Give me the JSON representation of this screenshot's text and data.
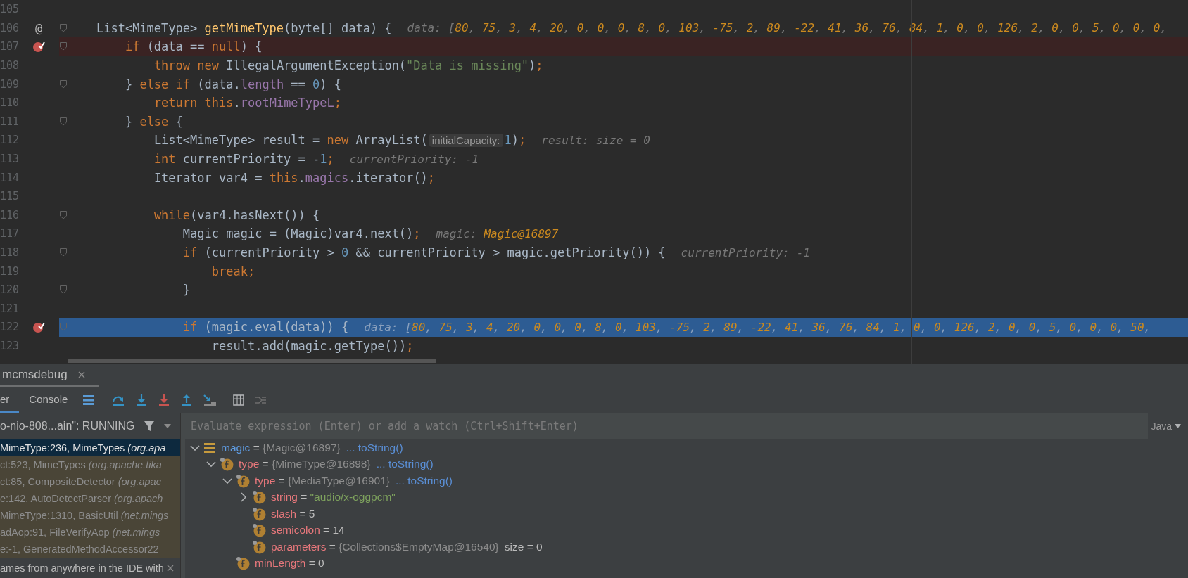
{
  "editor": {
    "lines": [
      {
        "number": "105",
        "fold": false,
        "breakpoint": false,
        "current": false
      },
      {
        "number": "106",
        "gutter_mark": "@",
        "fold": true,
        "breakpoint": false,
        "current": false,
        "segments": [
          {
            "kind": "code",
            "tokens": [
              {
                "kind": "pl",
                "text": "List<MimeType> "
              },
              {
                "kind": "decl",
                "text": "getMimeType"
              },
              {
                "kind": "pl",
                "text": "(byte[] data) {"
              }
            ]
          },
          {
            "kind": "hint",
            "label": "data:",
            "value": {
              "kind": "array",
              "text": "[80, 75, 3, 4, 20, 0, 0, 0, 8, 0, 103, -75, 2, 89, -22, 41, 36, 76, 84, 1, 0, 0, 126, 2, 0, 0, 5, 0, 0, 0,"
            }
          }
        ],
        "children": [
          {
            "number": "107",
            "fold": true,
            "breakpoint": true,
            "current": false,
            "segments": [
              {
                "kind": "code",
                "tokens": [
                  {
                    "kind": "kw",
                    "text": "if"
                  },
                  {
                    "kind": "pl",
                    "text": " (data == "
                  },
                  {
                    "kind": "kw",
                    "text": "null"
                  },
                  {
                    "kind": "pl",
                    "text": ") {"
                  }
                ]
              }
            ],
            "children": [
              {
                "number": "108",
                "fold": false,
                "breakpoint": false,
                "current": false,
                "segments": [
                  {
                    "kind": "code",
                    "tokens": [
                      {
                        "kind": "kw",
                        "text": "throw new "
                      },
                      {
                        "kind": "pl",
                        "text": "IllegalArgumentException("
                      },
                      {
                        "kind": "str",
                        "text": "\"Data is missing\""
                      },
                      {
                        "kind": "pl",
                        "text": ")"
                      },
                      {
                        "kind": "kw",
                        "text": ";"
                      }
                    ]
                  }
                ]
              }
            ]
          },
          {
            "number": "109",
            "fold": true,
            "breakpoint": false,
            "current": false,
            "segments": [
              {
                "kind": "code",
                "tokens": [
                  {
                    "kind": "pl",
                    "text": "} "
                  },
                  {
                    "kind": "kw",
                    "text": "else if"
                  },
                  {
                    "kind": "pl",
                    "text": " (data."
                  },
                  {
                    "kind": "fld",
                    "text": "length"
                  },
                  {
                    "kind": "pl",
                    "text": " == "
                  },
                  {
                    "kind": "num",
                    "text": "0"
                  },
                  {
                    "kind": "pl",
                    "text": ") {"
                  }
                ]
              }
            ],
            "children": [
              {
                "number": "110",
                "fold": false,
                "breakpoint": false,
                "current": false,
                "segments": [
                  {
                    "kind": "code",
                    "tokens": [
                      {
                        "kind": "kw",
                        "text": "return this"
                      },
                      {
                        "kind": "pl",
                        "text": "."
                      },
                      {
                        "kind": "fld",
                        "text": "rootMimeTypeL"
                      },
                      {
                        "kind": "kw",
                        "text": ";"
                      }
                    ]
                  }
                ]
              }
            ]
          },
          {
            "number": "111",
            "fold": true,
            "breakpoint": false,
            "current": false,
            "segments": [
              {
                "kind": "code",
                "tokens": [
                  {
                    "kind": "pl",
                    "text": "} "
                  },
                  {
                    "kind": "kw",
                    "text": "else"
                  },
                  {
                    "kind": "pl",
                    "text": " {"
                  }
                ]
              }
            ],
            "children": [
              {
                "number": "112",
                "fold": false,
                "breakpoint": false,
                "current": false,
                "segments": [
                  {
                    "kind": "code",
                    "tokens": [
                      {
                        "kind": "pl",
                        "text": "List<MimeType> result = "
                      },
                      {
                        "kind": "kw",
                        "text": "new "
                      },
                      {
                        "kind": "pl",
                        "text": "ArrayList("
                      }
                    ]
                  },
                  {
                    "kind": "chip",
                    "text": "initialCapacity:"
                  },
                  {
                    "kind": "code",
                    "tokens": [
                      {
                        "kind": "num",
                        "text": "1"
                      },
                      {
                        "kind": "pl",
                        "text": ")"
                      },
                      {
                        "kind": "kw",
                        "text": ";"
                      }
                    ]
                  },
                  {
                    "kind": "hint",
                    "label": "result:",
                    "value": {
                      "kind": "plain",
                      "text": "size = 0"
                    }
                  }
                ]
              },
              {
                "number": "113",
                "fold": false,
                "breakpoint": false,
                "current": false,
                "segments": [
                  {
                    "kind": "code",
                    "tokens": [
                      {
                        "kind": "kw",
                        "text": "int"
                      },
                      {
                        "kind": "pl",
                        "text": " currentPriority = -"
                      },
                      {
                        "kind": "num",
                        "text": "1"
                      },
                      {
                        "kind": "kw",
                        "text": ";"
                      }
                    ]
                  },
                  {
                    "kind": "hint",
                    "label": "currentPriority:",
                    "value": {
                      "kind": "plain",
                      "text": "-1"
                    }
                  }
                ]
              },
              {
                "number": "114",
                "fold": false,
                "breakpoint": false,
                "current": false,
                "segments": [
                  {
                    "kind": "code",
                    "tokens": [
                      {
                        "kind": "pl",
                        "text": "Iterator var4 = "
                      },
                      {
                        "kind": "kw",
                        "text": "this"
                      },
                      {
                        "kind": "pl",
                        "text": "."
                      },
                      {
                        "kind": "fld",
                        "text": "magics"
                      },
                      {
                        "kind": "pl",
                        "text": ".iterator()"
                      },
                      {
                        "kind": "kw",
                        "text": ";"
                      }
                    ]
                  }
                ]
              },
              {
                "number": "115",
                "fold": false,
                "breakpoint": false,
                "current": false
              },
              {
                "number": "116",
                "fold": true,
                "breakpoint": false,
                "current": false,
                "segments": [
                  {
                    "kind": "code",
                    "tokens": [
                      {
                        "kind": "kw",
                        "text": "while"
                      },
                      {
                        "kind": "pl",
                        "text": "(var4.hasNext()) {"
                      }
                    ]
                  }
                ],
                "children": [
                  {
                    "number": "117",
                    "fold": false,
                    "breakpoint": false,
                    "current": false,
                    "segments": [
                      {
                        "kind": "code",
                        "tokens": [
                          {
                            "kind": "pl",
                            "text": "Magic magic = (Magic)var4.next()"
                          },
                          {
                            "kind": "kw",
                            "text": ";"
                          }
                        ]
                      },
                      {
                        "kind": "hint",
                        "label": "magic:",
                        "value": {
                          "kind": "object",
                          "text": "Magic@16897"
                        }
                      }
                    ]
                  },
                  {
                    "number": "118",
                    "fold": true,
                    "breakpoint": false,
                    "current": false,
                    "segments": [
                      {
                        "kind": "code",
                        "tokens": [
                          {
                            "kind": "kw",
                            "text": "if"
                          },
                          {
                            "kind": "pl",
                            "text": " (currentPriority > "
                          },
                          {
                            "kind": "num",
                            "text": "0"
                          },
                          {
                            "kind": "pl",
                            "text": " && currentPriority > magic.getPriority()) {"
                          }
                        ]
                      },
                      {
                        "kind": "hint",
                        "label": "currentPriority:",
                        "value": {
                          "kind": "plain",
                          "text": "-1"
                        }
                      }
                    ],
                    "children": [
                      {
                        "number": "119",
                        "fold": false,
                        "breakpoint": false,
                        "current": false,
                        "segments": [
                          {
                            "kind": "code",
                            "tokens": [
                              {
                                "kind": "kw",
                                "text": "break;"
                              }
                            ]
                          }
                        ]
                      }
                    ]
                  },
                  {
                    "number": "120",
                    "fold": true,
                    "breakpoint": false,
                    "current": false,
                    "segments": [
                      {
                        "kind": "code",
                        "tokens": [
                          {
                            "kind": "pl",
                            "text": "}"
                          }
                        ]
                      }
                    ]
                  },
                  {
                    "number": "121",
                    "fold": false,
                    "breakpoint": false,
                    "current": false
                  },
                  {
                    "number": "122",
                    "fold": true,
                    "breakpoint": true,
                    "current": true,
                    "segments": [
                      {
                        "kind": "code",
                        "tokens": [
                          {
                            "kind": "kw",
                            "text": "if"
                          },
                          {
                            "kind": "pl",
                            "text": " (magic.eval(data)) {"
                          }
                        ]
                      },
                      {
                        "kind": "hint",
                        "label": "data:",
                        "value": {
                          "kind": "array",
                          "text": "[80, 75, 3, 4, 20, 0, 0, 0, 8, 0, 103, -75, 2, 89, -22, 41, 36, 76, 84, 1, 0, 0, 126, 2, 0, 0, 5, 0, 0, 0, 50,"
                        }
                      }
                    ],
                    "children": [
                      {
                        "number": "123",
                        "fold": false,
                        "breakpoint": false,
                        "current": false,
                        "segments": [
                          {
                            "kind": "code",
                            "tokens": [
                              {
                                "kind": "pl",
                                "text": "result.add(magic.getType())"
                              },
                              {
                                "kind": "kw",
                                "text": ";"
                              }
                            ]
                          }
                        ]
                      }
                    ]
                  }
                ]
              }
            ]
          }
        ]
      }
    ]
  },
  "debug_panel": {
    "session_tab": {
      "label": "mcmsdebug",
      "selected": true
    },
    "tabs": [
      {
        "label": "er",
        "selected": true
      },
      {
        "label": "Console",
        "selected": false
      }
    ],
    "thread": "o-nio-808...ain\": RUNNING",
    "evaluate": {
      "placeholder": "Evaluate expression (Enter) or add a watch (Ctrl+Shift+Enter)",
      "language": "Java"
    },
    "frames": [
      {
        "method": "MimeType:236, MimeTypes",
        "package": "(org.apa",
        "selected": true,
        "library": false
      },
      {
        "method": "ct:523, MimeTypes",
        "package": "(org.apache.tika",
        "selected": false,
        "library": true
      },
      {
        "method": "ct:85, CompositeDetector",
        "package": "(org.apac",
        "selected": false,
        "library": true
      },
      {
        "method": "e:142, AutoDetectParser",
        "package": "(org.apach",
        "selected": false,
        "library": true
      },
      {
        "method": "MimeType:1310, BasicUtil",
        "package": "(net.mings",
        "selected": false,
        "library": true
      },
      {
        "method": "adAop:91, FileVerifyAop",
        "package": "(net.mings",
        "selected": false,
        "library": true
      },
      {
        "method": "e:-1, GeneratedMethodAccessor22",
        "selected": false,
        "library": true
      }
    ],
    "frames_hint": "ames from anywhere in the IDE with",
    "variables": [
      {
        "name": "magic",
        "equals": "=",
        "kind": "local",
        "expanded": true,
        "value": {
          "kind": "object",
          "text": "{Magic@16897}"
        },
        "link": "... toString()",
        "children": [
          {
            "name": "type",
            "equals": "=",
            "kind": "field",
            "expanded": true,
            "value": {
              "kind": "object",
              "text": "{MimeType@16898}"
            },
            "link": "... toString()",
            "children": [
              {
                "name": "type",
                "equals": "=",
                "kind": "field",
                "expanded": true,
                "value": {
                  "kind": "object",
                  "text": "{MediaType@16901}"
                },
                "link": "... toString()",
                "children": [
                  {
                    "name": "string",
                    "equals": "=",
                    "kind": "field",
                    "expanded": false,
                    "value": {
                      "kind": "string",
                      "text": "\"audio/x-oggpcm\""
                    }
                  },
                  {
                    "name": "slash",
                    "equals": "=",
                    "kind": "field",
                    "value": {
                      "kind": "number",
                      "text": "5"
                    }
                  },
                  {
                    "name": "semicolon",
                    "equals": "=",
                    "kind": "field",
                    "value": {
                      "kind": "number",
                      "text": "14"
                    }
                  },
                  {
                    "name": "parameters",
                    "equals": "=",
                    "kind": "field",
                    "value": {
                      "kind": "object",
                      "text": "{Collections$EmptyMap@16540}"
                    },
                    "extra": "size = 0"
                  }
                ]
              },
              {
                "name": "minLength",
                "equals": "=",
                "kind": "field",
                "value": {
                  "kind": "number",
                  "text": "0"
                }
              }
            ]
          }
        ]
      }
    ]
  }
}
